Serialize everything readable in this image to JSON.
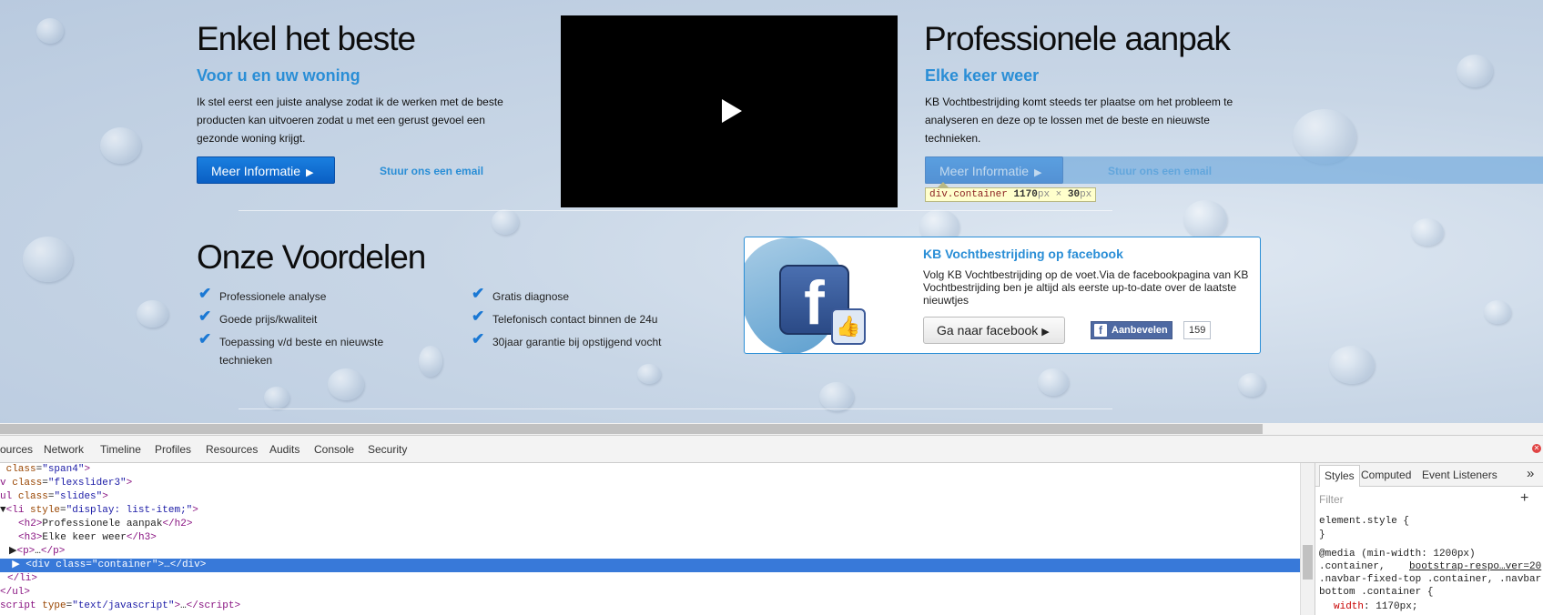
{
  "website": {
    "left_col": {
      "title": "Enkel het beste",
      "subtitle": "Voor u en uw woning",
      "text": "Ik stel eerst een juiste analyse zodat ik de werken met de beste producten kan uitvoeren zodat u met een gerust gevoel een gezonde woning krijgt.",
      "button": "Meer Informatie",
      "button_icon": "▶",
      "mail_link": "Stuur ons een email"
    },
    "video": {
      "play_icon": "play-icon"
    },
    "right_col": {
      "title": "Professionele aanpak",
      "subtitle": "Elke keer weer",
      "text": "KB Vochtbestrijding komt steeds ter plaatse om het probleem te analyseren en deze op te lossen met de beste en nieuwste technieken.",
      "button": "Meer Informatie",
      "button_icon": "▶",
      "mail_link": "Stuur ons een email"
    },
    "inspector_tooltip": {
      "tag": "div.container",
      "width": "1170",
      "unit1": "px",
      "times": "×",
      "height": "30",
      "unit2": "px"
    },
    "voordelen": {
      "title": "Onze Voordelen",
      "items_left": [
        "Professionele analyse",
        "Goede prijs/kwaliteit",
        "Toepassing v/d beste en nieuwste technieken"
      ],
      "items_right": [
        "Gratis diagnose",
        "Telefonisch contact binnen de 24u",
        "30jaar garantie bij opstijgend vocht"
      ],
      "check_icon": "✔"
    },
    "facebook": {
      "title": "KB Vochtbestrijding op facebook",
      "text": "Volg KB Vochtbestrijding op de voet.Via de facebookpagina van KB Vochtbestrijding ben je altijd als eerste up-to-date over de laatste nieuwtjes",
      "button": "Ga naar facebook",
      "button_icon": "▶",
      "like_label": "Aanbevelen",
      "like_count": "159",
      "logo_letter": "f"
    }
  },
  "devtools": {
    "tabs": [
      "ources",
      "Network",
      "Timeline",
      "Profiles",
      "Resources",
      "Audits",
      "Console",
      "Security"
    ],
    "dom": {
      "l1_attr": "class",
      "l1_val": "\"span4\"",
      "l2_tag": "v",
      "l2_attr": "class",
      "l2_val": "\"flexslider3\"",
      "l3_tag": "ul",
      "l3_attr": "class",
      "l3_val": "\"slides\"",
      "l4_tag": "li",
      "l4_attr": "style",
      "l4_val": "\"display: list-item;\"",
      "l5_text": "Professionele aanpak",
      "l6_text": "Elke keer weer",
      "l7_text": "…",
      "l8_attr": "class",
      "l8_val": "\"container\"",
      "l8_text": "…",
      "l9_tag": "li",
      "l10_tag": "ul",
      "l11_tag": "script",
      "l11_attr": "type",
      "l11_val": "\"text/javascript\"",
      "l11_text": "…"
    },
    "styles": {
      "tabs": [
        "Styles",
        "Computed",
        "Event Listeners"
      ],
      "more": "»",
      "filter_placeholder": "Filter",
      "plus": "+",
      "element_style": "element.style {",
      "close_brace": "}",
      "media": "@media (min-width: 1200px)",
      "selector1": ".container,",
      "source": "bootstrap-respo…ver=20",
      "selector2": ".navbar-fixed-top .container, .navbar-",
      "selector3": "bottom .container {",
      "prop_name": "width",
      "prop_value": "1170px;"
    }
  }
}
